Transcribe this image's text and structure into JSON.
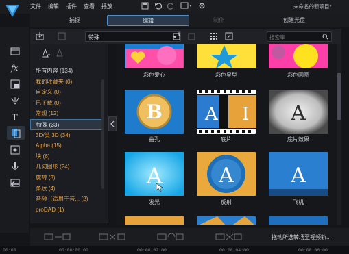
{
  "menu": [
    "文件",
    "编辑",
    "插件",
    "查看",
    "播放"
  ],
  "project_title": "未命名的新项目*",
  "mode_tabs": {
    "capture": "捕捉",
    "edit": "编辑",
    "produce": "制作",
    "disc": "创建光盘"
  },
  "library": {
    "dropdown_value": "特殊",
    "search_placeholder": "搜索库"
  },
  "categories": [
    {
      "label": "所有内容 (134)"
    },
    {
      "label": "我的收藏夹 (0)"
    },
    {
      "label": "自定义 (0)"
    },
    {
      "label": "已下载 (0)"
    },
    {
      "label": "常规 (12)"
    },
    {
      "label": "特殊 (33)"
    },
    {
      "label": "3D/类 3D  (34)"
    },
    {
      "label": "Alpha  (15)"
    },
    {
      "label": "块  (6)"
    },
    {
      "label": "几何图形  (24)"
    },
    {
      "label": "旋转  (3)"
    },
    {
      "label": "条纹  (4)"
    },
    {
      "label": "音频（适用于音...  (2)"
    },
    {
      "label": "proDAD  (1)"
    }
  ],
  "tiles": [
    {
      "label": "彩色爱心"
    },
    {
      "label": "彩色星型"
    },
    {
      "label": "彩色圆圈"
    },
    {
      "label": "曲孔"
    },
    {
      "label": "底片"
    },
    {
      "label": "底片效果"
    },
    {
      "label": "发光"
    },
    {
      "label": "反射"
    },
    {
      "label": "飞机"
    }
  ],
  "timeline_hint": "拖动所选转场至视频轨...",
  "ruler_ticks": [
    "00:00",
    "00:00:00:00",
    "00:00:02:00",
    "00:00:04:00",
    "00:00:06:00"
  ],
  "colors": {
    "accent_blue": "#4a8fd0",
    "highlight_orange": "#e2a34a",
    "bg": "#141518"
  }
}
